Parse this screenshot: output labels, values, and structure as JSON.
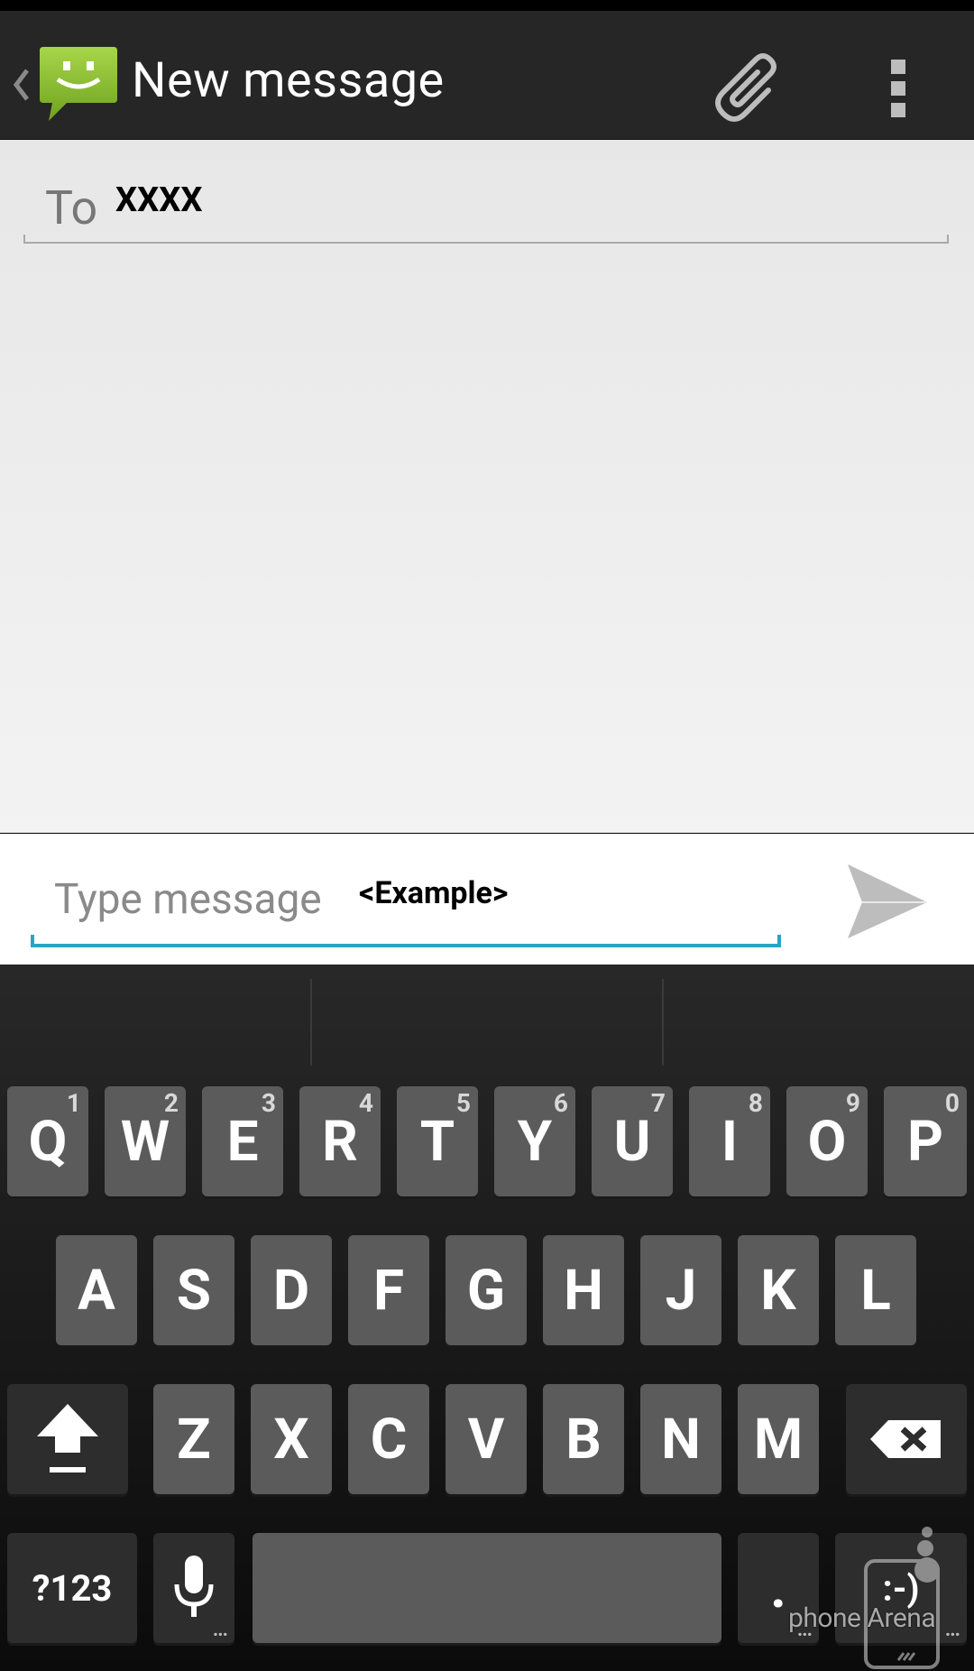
{
  "action_bar": {
    "title": "New message"
  },
  "recipient": {
    "label": "To",
    "value": "XXXX"
  },
  "composer": {
    "placeholder": "Type message",
    "example_text": "<Example>"
  },
  "keyboard": {
    "row1": [
      {
        "label": "Q",
        "hint": "1"
      },
      {
        "label": "W",
        "hint": "2"
      },
      {
        "label": "E",
        "hint": "3"
      },
      {
        "label": "R",
        "hint": "4"
      },
      {
        "label": "T",
        "hint": "5"
      },
      {
        "label": "Y",
        "hint": "6"
      },
      {
        "label": "U",
        "hint": "7"
      },
      {
        "label": "I",
        "hint": "8"
      },
      {
        "label": "O",
        "hint": "9"
      },
      {
        "label": "P",
        "hint": "0"
      }
    ],
    "row2": [
      "A",
      "S",
      "D",
      "F",
      "G",
      "H",
      "J",
      "K",
      "L"
    ],
    "row3": [
      "Z",
      "X",
      "C",
      "V",
      "B",
      "N",
      "M"
    ],
    "symbols_key": "?123",
    "period_key": ".",
    "emoticon_key": ":-)",
    "more_dots": "..."
  },
  "watermark": "phone Arena",
  "colors": {
    "action_bar_bg": "#262626",
    "accent": "#2da3c3",
    "app_icon_green": "#8bc34a",
    "key_bg": "#5b5b5b"
  },
  "icons": {
    "back": "chevron-left-icon",
    "app": "messaging-smiley-icon",
    "attach": "paperclip-icon",
    "overflow": "overflow-menu-icon",
    "send": "send-icon",
    "shift": "shift-icon",
    "backspace": "backspace-icon",
    "mic": "microphone-icon"
  }
}
